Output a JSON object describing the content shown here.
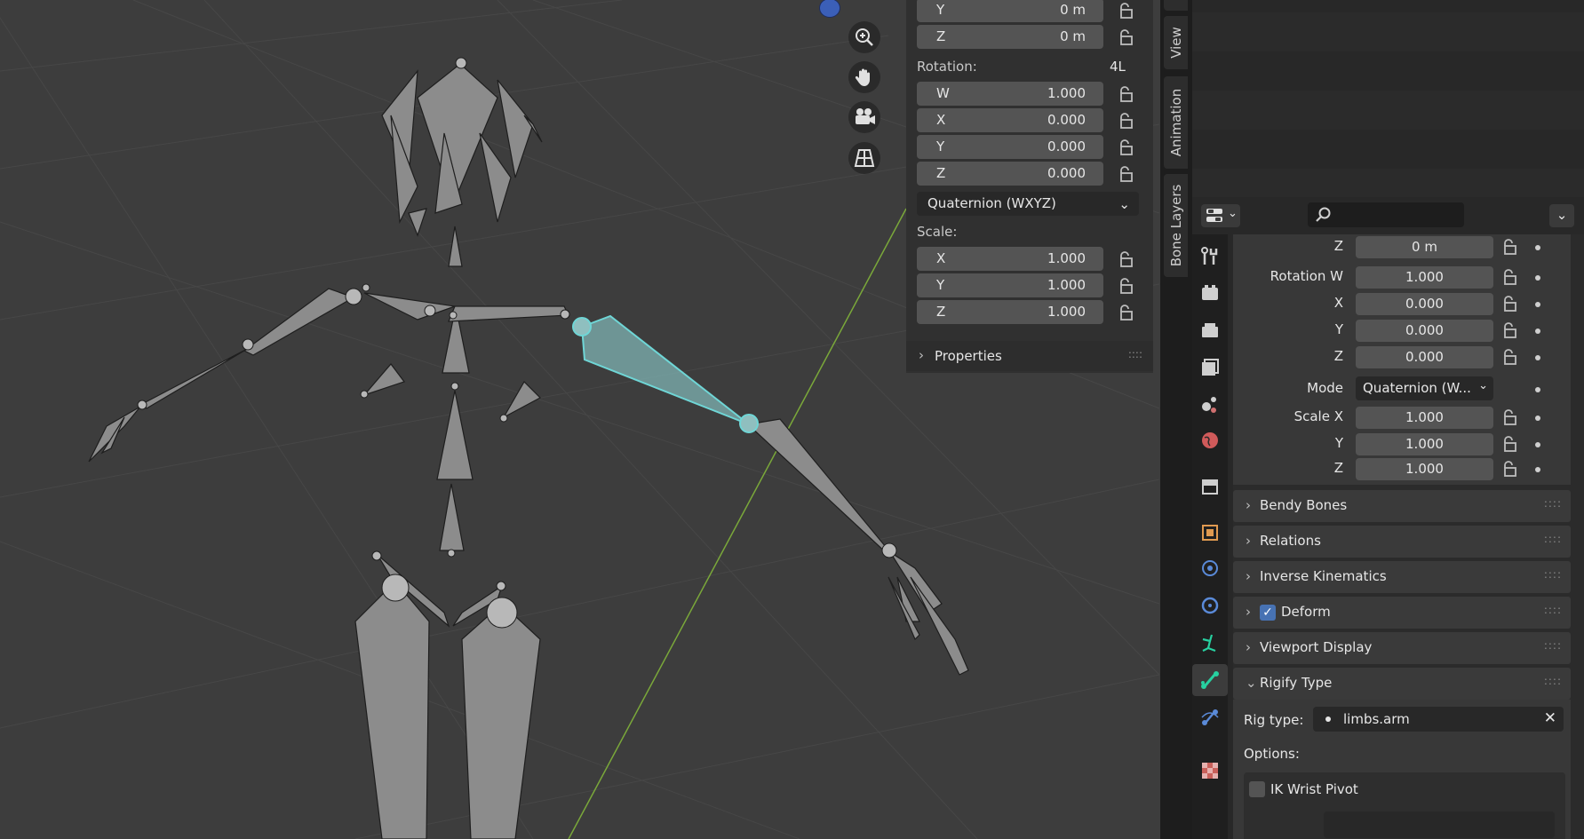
{
  "npanel": {
    "location_y": {
      "label": "Y",
      "value": "0 m"
    },
    "location_z": {
      "label": "Z",
      "value": "0 m"
    },
    "rotation_title": "Rotation:",
    "rotation_mode_short": "4L",
    "rotation": [
      {
        "label": "W",
        "value": "1.000"
      },
      {
        "label": "X",
        "value": "0.000"
      },
      {
        "label": "Y",
        "value": "0.000"
      },
      {
        "label": "Z",
        "value": "0.000"
      }
    ],
    "rotation_mode": "Quaternion (WXYZ)",
    "scale_title": "Scale:",
    "scale": [
      {
        "label": "X",
        "value": "1.000"
      },
      {
        "label": "Y",
        "value": "1.000"
      },
      {
        "label": "Z",
        "value": "1.000"
      }
    ],
    "properties_panel": "Properties"
  },
  "vertical_tabs": [
    "View",
    "Animation",
    "Bone Layers"
  ],
  "props": {
    "search_placeholder": "",
    "transform": {
      "location_z": {
        "label": "Z",
        "value": "0 m"
      },
      "rotation_w": {
        "label": "Rotation W",
        "value": "1.000"
      },
      "rotation_x": {
        "label": "X",
        "value": "0.000"
      },
      "rotation_y": {
        "label": "Y",
        "value": "0.000"
      },
      "rotation_z": {
        "label": "Z",
        "value": "0.000"
      },
      "mode": {
        "label": "Mode",
        "value": "Quaternion (W..."
      },
      "scale_x": {
        "label": "Scale X",
        "value": "1.000"
      },
      "scale_y": {
        "label": "Y",
        "value": "1.000"
      },
      "scale_z": {
        "label": "Z",
        "value": "1.000"
      }
    },
    "panels": [
      {
        "title": "Bendy Bones"
      },
      {
        "title": "Relations"
      },
      {
        "title": "Inverse Kinematics"
      },
      {
        "title": "Deform",
        "checked": true
      },
      {
        "title": "Viewport Display"
      },
      {
        "title": "Rigify Type",
        "expanded": true
      }
    ],
    "rigify": {
      "rig_type_label": "Rig type:",
      "rig_type_value": "limbs.arm",
      "options_label": "Options:",
      "ik_wrist_pivot": "IK Wrist Pivot"
    }
  },
  "colors": {
    "selection_outline": "#6fd6d6",
    "selected_bone_fill": "#7fb3b3",
    "y_axis_line": "#7aa83a",
    "checkbox_checked": "#4772b3",
    "active_tab_icon": "#27d0a0"
  }
}
